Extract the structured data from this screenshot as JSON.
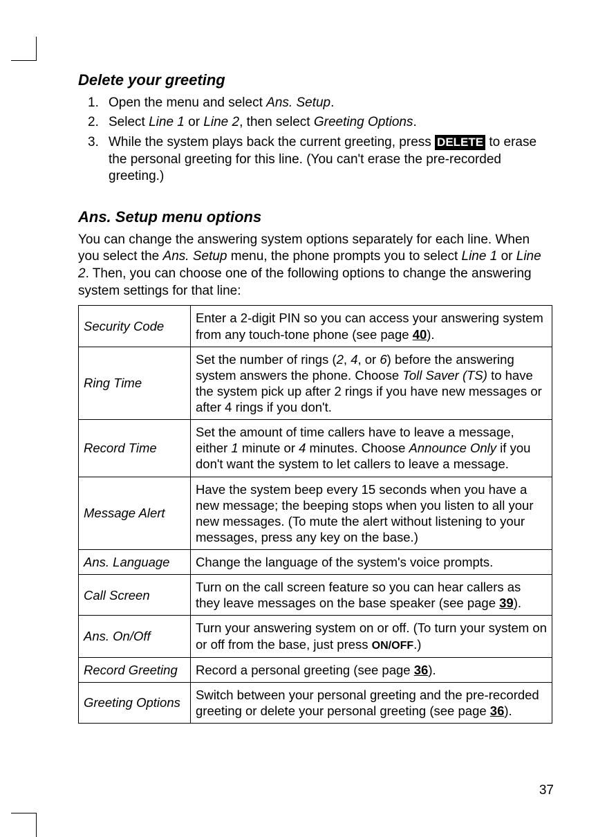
{
  "page_number": "37",
  "section1": {
    "title": "Delete your greeting",
    "step1_a": "Open the menu and select ",
    "step1_b": "Ans. Setup",
    "step1_c": ".",
    "step2_a": "Select ",
    "step2_b": "Line 1",
    "step2_c": " or ",
    "step2_d": "Line 2",
    "step2_e": ", then select ",
    "step2_f": "Greeting Options",
    "step2_g": ".",
    "step3_a": "While the system plays back the current greeting, press ",
    "step3_btn": "DELETE",
    "step3_b": " to erase the personal greeting for this line. (You can't erase the pre-recorded greeting.)"
  },
  "section2": {
    "title": "Ans. Setup menu options",
    "intro_a": "You can change the answering system options separately for each line. When you select the ",
    "intro_b": "Ans. Setup",
    "intro_c": " menu, the phone prompts you to select ",
    "intro_d": "Line 1",
    "intro_e": " or ",
    "intro_f": "Line 2",
    "intro_g": ". Then, you can choose one of the following options to change the answering system settings for that line:"
  },
  "table": {
    "r0": {
      "label": "Security Code",
      "a": "Enter a 2-digit PIN so you can access your answering system from any touch-tone phone (see page ",
      "pg": "40",
      "b": ")."
    },
    "r1": {
      "label": "Ring Time",
      "a": "Set the number of rings (",
      "n1": "2",
      "c1": ", ",
      "n2": "4",
      "c2": ", or ",
      "n3": "6",
      "c3": ") before the answering system answers the phone. Choose ",
      "opt": "Toll Saver (TS)",
      "d": " to have the system pick up after 2 rings if you have new messages or after 4 rings if you don't."
    },
    "r2": {
      "label": "Record Time",
      "a": "Set the amount of time callers have to leave a message, either ",
      "n1": "1",
      "c1": " minute or ",
      "n2": "4",
      "c2": " minutes. Choose ",
      "opt": "Announce Only",
      "d": " if you don't want the system to let callers to leave a message."
    },
    "r3": {
      "label": "Message Alert",
      "a": "Have the system beep every 15 seconds when you have a new message; the beeping stops when you listen to all your new messages. (To mute the alert without listening to your messages, press any key on the base.)"
    },
    "r4": {
      "label": "Ans. Language",
      "a": "Change the language of the system's voice prompts."
    },
    "r5": {
      "label": "Call Screen",
      "a": "Turn on the call screen feature so you can hear callers as they leave messages on the base speaker (see page ",
      "pg": "39",
      "b": ")."
    },
    "r6": {
      "label": "Ans. On/Off",
      "a": "Turn your answering system on or off. (To turn your system on or off from the base, just press ",
      "btn": "ON/OFF",
      "b": ".)"
    },
    "r7": {
      "label": "Record Greeting",
      "a": "Record a personal greeting (see page ",
      "pg": "36",
      "b": ")."
    },
    "r8": {
      "label": "Greeting Options",
      "a": "Switch between your personal greeting and the pre-recorded greeting or delete your personal greeting (see page ",
      "pg": "36",
      "b": ")."
    }
  }
}
